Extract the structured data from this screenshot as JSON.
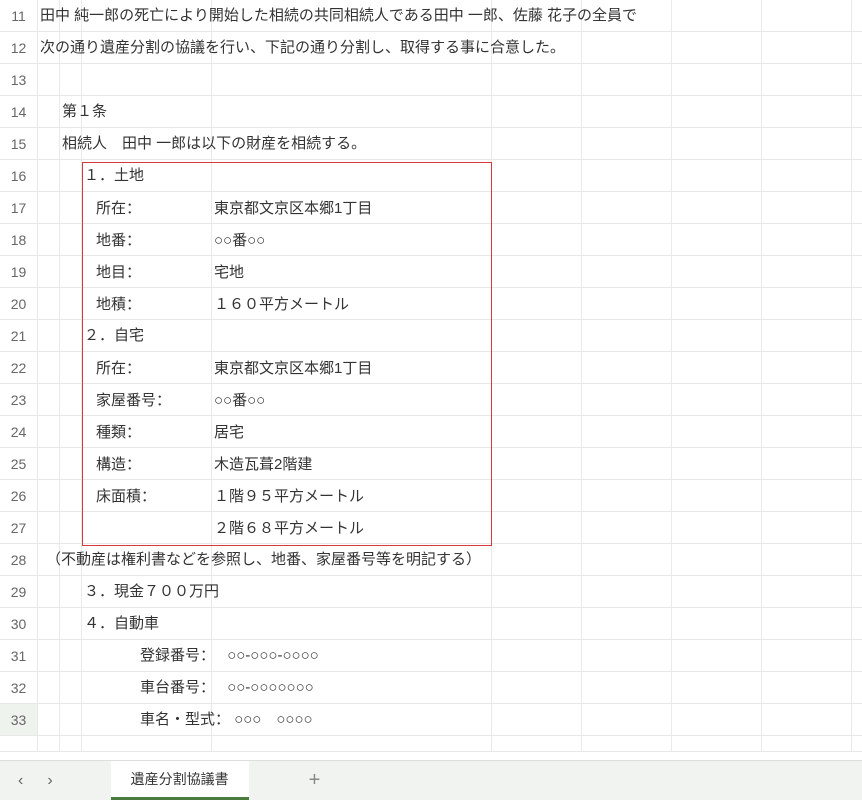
{
  "rows": {
    "11": {
      "num": "11",
      "text": "田中 純一郎の死亡により開始した相続の共同相続人である田中 一郎、佐藤 花子の全員で"
    },
    "12": {
      "num": "12",
      "text": "次の通り遺産分割の協議を行い、下記の通り分割し、取得する事に合意した。"
    },
    "13": {
      "num": "13"
    },
    "14": {
      "num": "14",
      "text": "第１条"
    },
    "15": {
      "num": "15",
      "text": "相続人　田中 一郎は以下の財産を相続する。"
    },
    "16": {
      "num": "16",
      "text": "１．土地"
    },
    "17": {
      "num": "17",
      "label": "所在：",
      "value": "東京都文京区本郷1丁目"
    },
    "18": {
      "num": "18",
      "label": "地番：",
      "value": "○○番○○"
    },
    "19": {
      "num": "19",
      "label": "地目：",
      "value": "宅地"
    },
    "20": {
      "num": "20",
      "label": "地積：",
      "value": "１６０平方メートル"
    },
    "21": {
      "num": "21",
      "text": "２．自宅"
    },
    "22": {
      "num": "22",
      "label": "所在：",
      "value": "東京都文京区本郷1丁目"
    },
    "23": {
      "num": "23",
      "label": "家屋番号：",
      "value": "○○番○○"
    },
    "24": {
      "num": "24",
      "label": "種類：",
      "value": "居宅"
    },
    "25": {
      "num": "25",
      "label": "構造：",
      "value": "木造瓦葺2階建"
    },
    "26": {
      "num": "26",
      "label": "床面積：",
      "value": "１階９５平方メートル"
    },
    "27": {
      "num": "27",
      "label": "",
      "value": "２階６８平方メートル"
    },
    "28": {
      "num": "28",
      "text": "（不動産は権利書などを参照し、地番、家屋番号等を明記する）"
    },
    "29": {
      "num": "29",
      "text": "３．現金７００万円"
    },
    "30": {
      "num": "30",
      "text": "４．自動車"
    },
    "31": {
      "num": "31",
      "label2": "登録番号：",
      "value2": "○○‐○○○‐○○○○"
    },
    "32": {
      "num": "32",
      "label2": "車台番号：",
      "value2": "○○‐○○○○○○○"
    },
    "33": {
      "num": "33",
      "label2": "車名・型式：",
      "value2": "○○○　○○○○"
    }
  },
  "tab": {
    "prev": "‹",
    "next": "›",
    "name": "遺産分割協議書",
    "add": "+"
  }
}
